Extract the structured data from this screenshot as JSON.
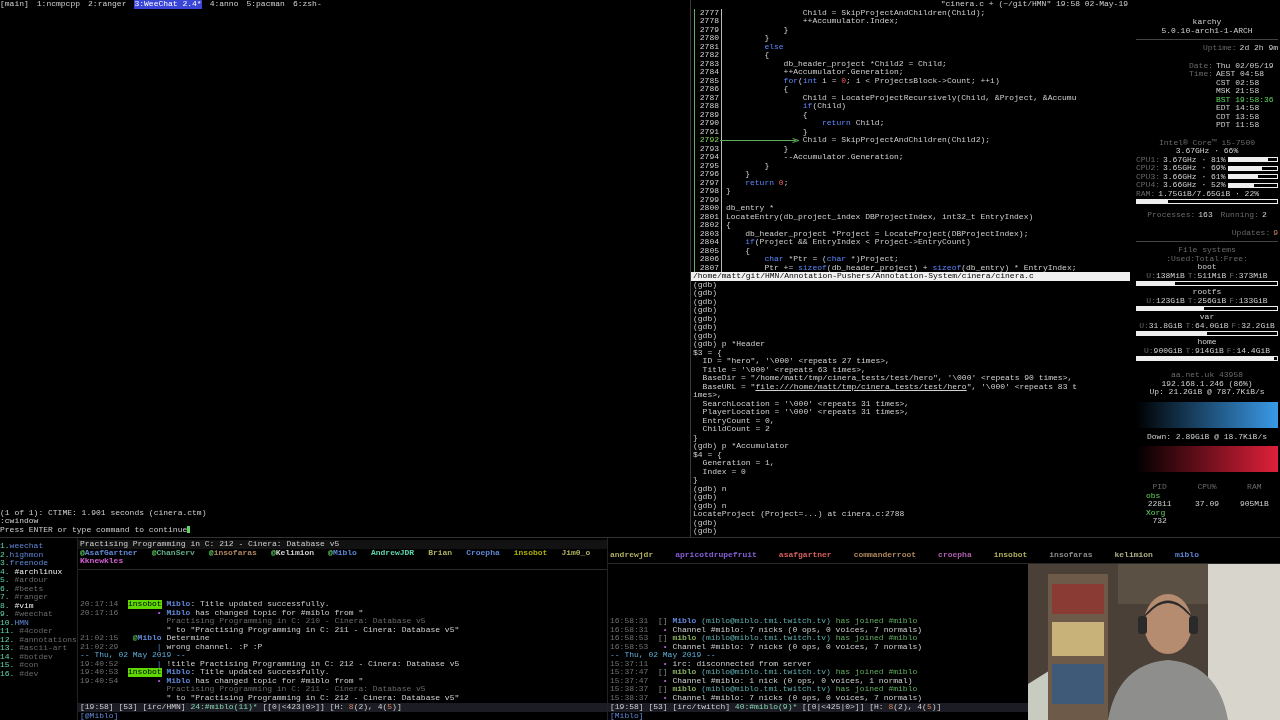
{
  "tmux": {
    "session": "[main]",
    "windows": [
      {
        "label": "1:ncmpcpp",
        "selected": false
      },
      {
        "label": "2:ranger",
        "selected": false
      },
      {
        "label": "3:WeeChat 2.4*",
        "selected": true
      },
      {
        "label": "4:anno",
        "selected": false
      },
      {
        "label": "5:pacman",
        "selected": false
      },
      {
        "label": "6:zsh-",
        "selected": false
      }
    ]
  },
  "vim_messages": [
    "(1 of 1): CTIME: 1.901 seconds (cinera.ctm)",
    ":cwindow",
    "Press ENTER or type command to continue"
  ],
  "code": {
    "title": "\"cinera.c + (~/git/HMN\" 19:58 02-May-19",
    "lines": [
      {
        "number": "2777",
        "current": false,
        "text": "                Child = SkipProjectAndChildren(Child);"
      },
      {
        "number": "2778",
        "current": false,
        "text": "                ++Accumulator.Index;"
      },
      {
        "number": "2779",
        "current": false,
        "text": "            }"
      },
      {
        "number": "2780",
        "current": false,
        "text": "        }"
      },
      {
        "number": "2781",
        "current": false,
        "text": [
          {
            "text": "        else",
            "kind": "kw"
          }
        ]
      },
      {
        "number": "2782",
        "current": false,
        "text": "        {"
      },
      {
        "number": "2783",
        "current": false,
        "text": "            db_header_project *Child2 = Child;"
      },
      {
        "number": "2784",
        "current": false,
        "text": "            ++Accumulator.Generation;"
      },
      {
        "number": "2785",
        "current": false,
        "text": [
          {
            "text": "            for",
            "kind": "kw"
          },
          {
            "text": "("
          },
          {
            "text": "int",
            "kind": "kw"
          },
          {
            "text": " i = "
          },
          {
            "text": "0",
            "kind": "num"
          },
          {
            "text": "; i < ProjectsBlock->Count; ++i)"
          }
        ]
      },
      {
        "number": "2786",
        "current": false,
        "text": "            {"
      },
      {
        "number": "2787",
        "current": false,
        "text": "                Child = LocateProjectRecursively(Child, &Project, &Accumu"
      },
      {
        "number": "2788",
        "current": false,
        "text": [
          {
            "text": "                if",
            "kind": "kw"
          },
          {
            "text": "(Child)"
          }
        ]
      },
      {
        "number": "2789",
        "current": false,
        "text": "                {"
      },
      {
        "number": "2790",
        "current": false,
        "text": [
          {
            "text": "                    return",
            "kind": "kw"
          },
          {
            "text": " Child;"
          }
        ]
      },
      {
        "number": "2791",
        "current": false,
        "text": "                }"
      },
      {
        "number": "2792",
        "current": true,
        "text": "                Child = SkipProjectAndChildren(Child2);"
      },
      {
        "number": "2793",
        "current": false,
        "text": "            }"
      },
      {
        "number": "2794",
        "current": false,
        "text": "            --Accumulator.Generation;"
      },
      {
        "number": "2795",
        "current": false,
        "text": "        }"
      },
      {
        "number": "2796",
        "current": false,
        "text": "    }"
      },
      {
        "number": "2797",
        "current": false,
        "text": [
          {
            "text": "    return",
            "kind": "kw"
          },
          {
            "text": " 0",
            "kind": "num"
          },
          {
            "text": ";"
          }
        ]
      },
      {
        "number": "2798",
        "current": false,
        "text": "}"
      },
      {
        "number": "2799",
        "current": false
      },
      {
        "number": "2800",
        "current": false,
        "text": "db_entry *"
      },
      {
        "number": "2801",
        "current": false,
        "text": "LocateEntry(db_project_index DBProjectIndex, int32_t EntryIndex)"
      },
      {
        "number": "2802",
        "current": false,
        "text": "{"
      },
      {
        "number": "2803",
        "current": false,
        "text": "    db_header_project *Project = LocateProject(DBProjectIndex);"
      },
      {
        "number": "2804",
        "current": false,
        "text": [
          {
            "text": "    if",
            "kind": "kw"
          },
          {
            "text": "(Project && EntryIndex < Project->EntryCount)"
          }
        ]
      },
      {
        "number": "2805",
        "current": false,
        "text": "    {"
      },
      {
        "number": "2806",
        "current": false,
        "text": [
          {
            "text": "        char",
            "kind": "kw"
          },
          {
            "text": " *Ptr = ("
          },
          {
            "text": "char",
            "kind": "kw"
          },
          {
            "text": " *)Project;"
          }
        ]
      },
      {
        "number": "2807",
        "current": false,
        "text": [
          {
            "text": "        Ptr += "
          },
          {
            "text": "sizeof",
            "kind": "kw"
          },
          {
            "text": "(db_header_project) + "
          },
          {
            "text": "sizeof",
            "kind": "kw"
          },
          {
            "text": "(db_entry) * EntryIndex;"
          }
        ]
      }
    ],
    "file_path": "/home/matt/git/HMN/Annotation-Pushers/Annotation-System/cinera/cinera.c"
  },
  "gdb": {
    "lines": [
      "(gdb)",
      "(gdb)",
      "(gdb)",
      "(gdb)",
      "(gdb)",
      "(gdb)",
      "(gdb)",
      "(gdb) p *Header",
      "$3 = {",
      "  ID = \"hero\", '\\000' <repeats 27 times>,",
      "  Title = '\\000' <repeats 63 times>,",
      "  BaseDir = \"/home/matt/tmp/cinera_tests/test/hero\", '\\000' <repeats 90 times>,",
      [
        {
          "text": "  BaseURL = \""
        },
        {
          "text": "file:///home/matt/tmp/cinera_tests/test/hero",
          "kind": "link"
        },
        {
          "text": "\", '\\000' <repeats 83 t"
        }
      ],
      "imes>,",
      "  SearchLocation = '\\000' <repeats 31 times>,",
      "  PlayerLocation = '\\000' <repeats 31 times>,",
      "  EntryCount = 0,",
      "  ChildCount = 2",
      "}",
      "(gdb) p *Accumulator",
      "$4 = {",
      "  Generation = 1,",
      "  Index = 0",
      "}",
      "(gdb) n",
      "(gdb)",
      "(gdb) n",
      "LocateProject (Project=...) at cinera.c:2788",
      "(gdb)",
      "(gdb)"
    ]
  },
  "sysmon": {
    "host": "karchy",
    "kernel": "5.0.10-arch1-1-ARCH",
    "uptime": {
      "label": "Uptime:",
      "value": "2d 2h 9m"
    },
    "date": {
      "label": "Date:",
      "value": "Thu 02/05/19"
    },
    "time_label": "Time:",
    "clocks": [
      {
        "text": "AEST 04:58",
        "selected": false
      },
      {
        "text": "CST 02:58",
        "selected": false
      },
      {
        "text": "MSK 21:58",
        "selected": false
      },
      {
        "text": "BST 19:58:36",
        "selected": true
      },
      {
        "text": "EDT 14:58",
        "selected": false
      },
      {
        "text": "CDT 13:58",
        "selected": false
      },
      {
        "text": "PDT 11:58",
        "selected": false
      }
    ],
    "cpu_model": "Intel® Core™ i5-7500",
    "cpu_summary": "3.67GHz · 66%",
    "cpus": [
      {
        "label": "CPU1:",
        "reading": "3.67GHz · 81%",
        "level": 0.81
      },
      {
        "label": "CPU2:",
        "reading": "3.65GHz · 69%",
        "level": 0.69
      },
      {
        "label": "CPU3:",
        "reading": "3.66GHz · 61%",
        "level": 0.61
      },
      {
        "label": "CPU4:",
        "reading": "3.66GHz · 52%",
        "level": 0.52
      }
    ],
    "ram": {
      "label": "RAM:",
      "reading": "1.75GiB/7.65GiB · 22%",
      "level": 0.22
    },
    "processes": {
      "label": "Processes:",
      "value": "163"
    },
    "running": {
      "label": "Running:",
      "value": "2"
    },
    "updates": {
      "label": "Updates:",
      "value": "9"
    },
    "fs_title": "File systems",
    "fs_subtitle": ":Used:Total:Free:",
    "filesystems": [
      {
        "name": "boot",
        "level": 0.27,
        "stats": [
          {
            "label": "U:",
            "value": "138MiB"
          },
          {
            "label": "T:",
            "value": "511MiB"
          },
          {
            "label": "F:",
            "value": "373MiB"
          }
        ]
      },
      {
        "name": "rootfs",
        "level": 0.48,
        "stats": [
          {
            "label": "U:",
            "value": "123GiB"
          },
          {
            "label": "T:",
            "value": "256GiB"
          },
          {
            "label": "F:",
            "value": "133GiB"
          }
        ]
      },
      {
        "name": "var",
        "level": 0.5,
        "stats": [
          {
            "label": "U:",
            "value": "31.8GiB"
          },
          {
            "label": "T:",
            "value": "64.0GiB"
          },
          {
            "label": "F:",
            "value": "32.2GiB"
          }
        ]
      },
      {
        "name": "home",
        "level": 0.98,
        "stats": [
          {
            "label": "U:",
            "value": "900GiB"
          },
          {
            "label": "T:",
            "value": "914GiB"
          },
          {
            "label": "F:",
            "value": "14.4GiB"
          }
        ]
      }
    ],
    "network": {
      "host": "aa.net.uk 43958",
      "address": "192.168.1.246 (86%)",
      "up": "Up: 21.2GiB @ 787.7KiB/s",
      "down": "Down: 2.89GiB @ 18.7KiB/s"
    },
    "top": {
      "columns": [
        "PID",
        "CPU%",
        "RAM"
      ],
      "rows": [
        {
          "name": "obs",
          "pid": "22811",
          "cpu": "37.09",
          "ram": "905MiB"
        },
        {
          "name": "Xorg",
          "pid": "732"
        }
      ]
    }
  },
  "weechat_left": {
    "buffers": [
      {
        "number": "1.",
        "name": "weechat",
        "kind": "server"
      },
      {
        "number": "2.",
        "name": "highmon",
        "kind": "server"
      },
      {
        "number": "3.",
        "name": "freenode",
        "kind": "server"
      },
      {
        "number": "4.",
        "name": " #archlinux",
        "kind": "channel"
      },
      {
        "number": "5.",
        "name": " #ardour",
        "kind": "inactive"
      },
      {
        "number": "6.",
        "name": " #beets",
        "kind": "inactive"
      },
      {
        "number": "7.",
        "name": " #ranger",
        "kind": "inactive"
      },
      {
        "number": "8.",
        "name": " #vim",
        "kind": "channel"
      },
      {
        "number": "9.",
        "name": " #weechat",
        "kind": "inactive"
      },
      {
        "number": "10.",
        "name": "HMN",
        "kind": "server"
      },
      {
        "number": "11.",
        "name": " #4coder",
        "kind": "inactive"
      },
      {
        "number": "12.",
        "name": " #annotations",
        "kind": "inactive"
      },
      {
        "number": "13.",
        "name": " #ascii-art",
        "kind": "inactive"
      },
      {
        "number": "14.",
        "name": " #botdev",
        "kind": "inactive"
      },
      {
        "number": "15.",
        "name": " #con",
        "kind": "inactive"
      },
      {
        "number": "16.",
        "name": " #dev",
        "kind": "inactive"
      }
    ],
    "title": "Practising Programming in C: 212 - Cinera: Database v5",
    "nicks": [
      {
        "op": "@",
        "name": "AsafGartner",
        "color": "#5f87d7"
      },
      {
        "op": "@",
        "name": "ChanServ",
        "color": "#5faf87"
      },
      {
        "op": "@",
        "name": "insofaras",
        "color": "#af875f"
      },
      {
        "op": "@",
        "name": "Kelimion",
        "color": "#d0d0d0"
      },
      {
        "op": "@",
        "name": "Miblo",
        "color": "#5f87d7"
      },
      {
        "name": "AndrewJDR",
        "color": "#5fd7af"
      },
      {
        "name": "Brian",
        "color": "#afaf5f"
      },
      {
        "name": "Croepha",
        "color": "#5f87d7"
      },
      {
        "name": "insobot",
        "color": "#afaf00"
      },
      {
        "name": "Jim0_o",
        "color": "#afaf5f"
      },
      {
        "name": "Kknewkles",
        "color": "#d75fd7"
      }
    ],
    "messages": [
      {
        "kind": "highlight",
        "time": "20:17:14",
        "prefix": "insobot",
        "text": [
          {
            "text": "Miblo",
            "color": "#5f87d7"
          },
          {
            "text": ": Title updated successfully."
          }
        ]
      },
      {
        "kind": "action",
        "time": "20:17:16",
        "prefix": "•",
        "text": [
          {
            "text": "Miblo",
            "color": "#5f87d7"
          },
          {
            "text": " has changed topic for #miblo from \""
          },
          {
            "text": "Practising Programming in C: 210 - Cinera: Database v5",
            "kind": "dim"
          },
          {
            "text": "\" to \"Practising Programming in C: 211 - Cinera: Database v5\""
          }
        ]
      },
      {
        "kind": "nick",
        "time": "21:02:15",
        "prefix": [
          {
            "text": "@",
            "kind": "op"
          },
          {
            "text": "Miblo",
            "color": "#5f87d7"
          }
        ],
        "text": "Determine"
      },
      {
        "kind": "continuation",
        "time": "21:02:29",
        "prefix": "|",
        "text": "wrong channel. :P :P"
      },
      {
        "kind": "day",
        "text": "-- Thu, 02 May 2019 --"
      },
      {
        "kind": "continuation",
        "time": "19:40:52",
        "prefix": "|",
        "text": "!title Practising Programming in C: 212 - Cinera: Database v5"
      },
      {
        "kind": "highlight",
        "time": "19:40:53",
        "prefix": "insobot",
        "text": [
          {
            "text": "Miblo",
            "color": "#5f87d7"
          },
          {
            "text": ": Title updated successfully."
          }
        ]
      },
      {
        "kind": "action",
        "time": "19:40:54",
        "prefix": "•",
        "text": [
          {
            "text": "Miblo",
            "color": "#5f87d7"
          },
          {
            "text": " has changed topic for #miblo from \""
          },
          {
            "text": "Practising Programming in C: 211 - Cinera: Database v5",
            "kind": "dim"
          },
          {
            "text": "\" to \"Practising Programming in C: 212 - Cinera: Database v5\""
          }
        ]
      }
    ],
    "status": [
      {
        "text": "[19:58] [53] [irc/HMN] "
      },
      {
        "text": "24:#miblo(11)*",
        "kind": "accent"
      },
      {
        "text": " [[0|<423|0>]] [H: "
      },
      {
        "text": "8",
        "kind": "hot"
      },
      {
        "text": "(2)"
      },
      {
        "text": ", 4("
      },
      {
        "text": "5",
        "kind": "hot"
      },
      {
        "text": ")]"
      }
    ],
    "input": "[@Miblo]"
  },
  "weechat_right": {
    "nicks": [
      {
        "name": "andrewjdr",
        "color": "#afaf5f"
      },
      {
        "name": "apricotdrupefruit",
        "color": "#875fd7"
      },
      {
        "name": "asafgartner",
        "color": "#d75f5f"
      },
      {
        "name": "commanderroot",
        "color": "#af875f"
      },
      {
        "name": "croepha",
        "color": "#af5faf"
      },
      {
        "name": "insobot",
        "color": "#afaf5f"
      },
      {
        "name": "insofaras",
        "color": "#8a8a8a"
      },
      {
        "name": "kelimion",
        "color": "#afaf87"
      },
      {
        "name": "miblo",
        "color": "#5f87d7"
      }
    ],
    "messages": [
      {
        "kind": "join",
        "time": "16:58:31",
        "prefix": "[]",
        "text": [
          {
            "text": "Miblo",
            "color": "#5f87d7"
          },
          {
            "text": " (miblo@miblo.tmi.twitch.tv) ",
            "kind": "host"
          },
          {
            "text": "has joined #miblo",
            "kind": "join"
          }
        ]
      },
      {
        "kind": "network",
        "time": "16:58:31",
        "prefix": "•",
        "text": "Channel #miblo: 7 nicks (0 ops, 0 voices, 7 normals)"
      },
      {
        "kind": "join",
        "time": "16:58:53",
        "prefix": "[]",
        "text": [
          {
            "text": "miblo",
            "color": "#87af5f"
          },
          {
            "text": " (miblo@miblo.tmi.twitch.tv) ",
            "kind": "host"
          },
          {
            "text": "has joined #miblo",
            "kind": "join"
          }
        ]
      },
      {
        "kind": "network",
        "time": "16:58:53",
        "prefix": "•",
        "text": "Channel #miblo: 7 nicks (0 ops, 0 voices, 7 normals)"
      },
      {
        "kind": "day",
        "text": "-- Thu, 02 May 2019 --"
      },
      {
        "kind": "network",
        "time": "15:37:11",
        "prefix": "•",
        "text": "irc: disconnected from server"
      },
      {
        "kind": "join",
        "time": "15:37:47",
        "prefix": "[]",
        "text": [
          {
            "text": "miblo",
            "color": "#87af5f"
          },
          {
            "text": " (miblo@miblo.tmi.twitch.tv) ",
            "kind": "host"
          },
          {
            "text": "has joined #miblo",
            "kind": "join"
          }
        ]
      },
      {
        "kind": "network",
        "time": "15:37:47",
        "prefix": "•",
        "text": "Channel #miblo: 1 nick (0 ops, 0 voices, 1 normal)"
      },
      {
        "kind": "join",
        "time": "15:38:37",
        "prefix": "[]",
        "text": [
          {
            "text": "miblo",
            "color": "#87af5f"
          },
          {
            "text": " (miblo@miblo.tmi.twitch.tv) ",
            "kind": "host"
          },
          {
            "text": "has joined #miblo",
            "kind": "join"
          }
        ]
      },
      {
        "kind": "network",
        "time": "15:38:37",
        "prefix": "•",
        "text": "Channel #miblo: 7 nicks (0 ops, 0 voices, 7 normals)"
      }
    ],
    "status": [
      {
        "text": "[19:58] [53] [irc/twitch] "
      },
      {
        "text": "40:#miblo(9)*",
        "kind": "accent"
      },
      {
        "text": " [[0|<425|0>]] [H: "
      },
      {
        "text": "8",
        "kind": "hot"
      },
      {
        "text": "(2)"
      },
      {
        "text": ", 4("
      },
      {
        "text": "5",
        "kind": "hot"
      },
      {
        "text": ")]"
      }
    ],
    "input": "[Miblo]"
  },
  "webcam": {
    "kind": "picture"
  }
}
